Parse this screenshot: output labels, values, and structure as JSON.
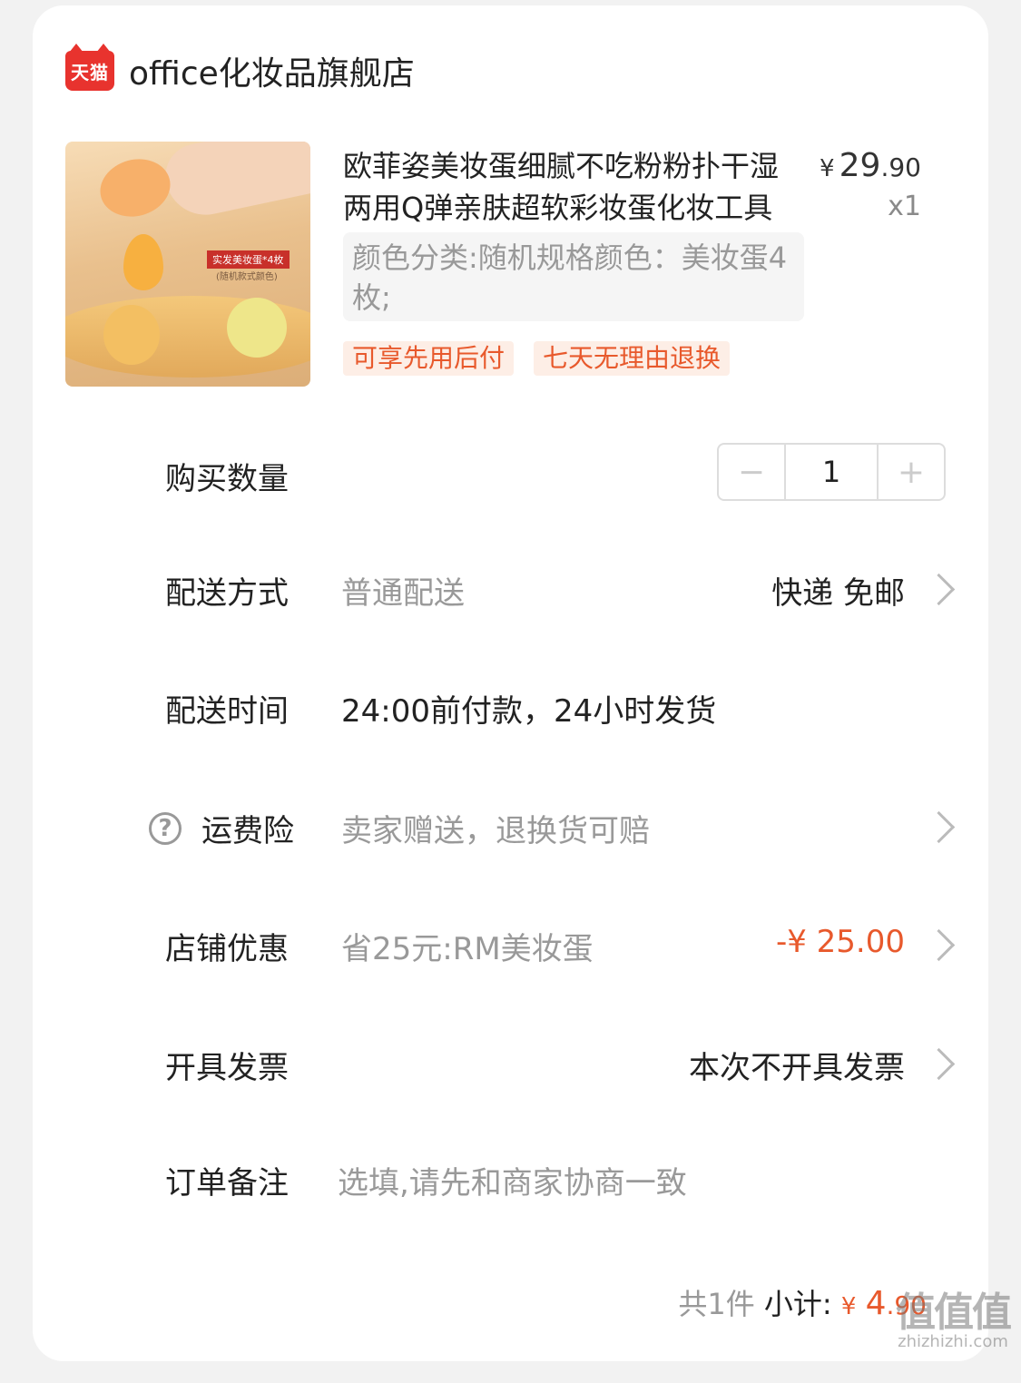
{
  "store": {
    "badge": "天猫",
    "name": "office化妆品旗舰店"
  },
  "product": {
    "image_label": "实发美妆蛋*4枚",
    "image_sub": "(随机款式颜色)",
    "title": "欧菲姿美妆蛋细腻不吃粉粉扑干湿两用Q弹亲肤超软彩妆蛋化妆工具",
    "price_symbol": "¥",
    "price_int": "29",
    "price_dec": ".90",
    "quantity": "x1",
    "spec": "颜色分类:随机规格颜色：美妆蛋4枚;",
    "tags": [
      "可享先用后付",
      "七天无理由退换"
    ]
  },
  "rows": {
    "quantity": {
      "label": "购买数量",
      "minus": "−",
      "value": "1",
      "plus": "+"
    },
    "delivery": {
      "label": "配送方式",
      "value": "普通配送",
      "right": "快递 免邮"
    },
    "delivery_time": {
      "label": "配送时间",
      "value": "24:00前付款，24小时发货"
    },
    "insurance": {
      "icon": "?",
      "label": "运费险",
      "value": "卖家赠送，退换货可赔"
    },
    "discount": {
      "label": "店铺优惠",
      "value": "省25元:RM美妆蛋",
      "right": "-¥ 25.00"
    },
    "invoice": {
      "label": "开具发票",
      "right": "本次不开具发票"
    },
    "note": {
      "label": "订单备注",
      "placeholder": "选填,请先和商家协商一致"
    }
  },
  "summary": {
    "count": "共1件",
    "subtotal_label": "小计:",
    "symbol": "¥",
    "int": "4",
    "dec": ".90"
  },
  "watermark": {
    "main": "值值值",
    "sub": "zhizhizhi.com"
  },
  "colors": {
    "accent": "#e8592c",
    "tmall_red": "#e8332e",
    "muted_text": "#999999"
  }
}
